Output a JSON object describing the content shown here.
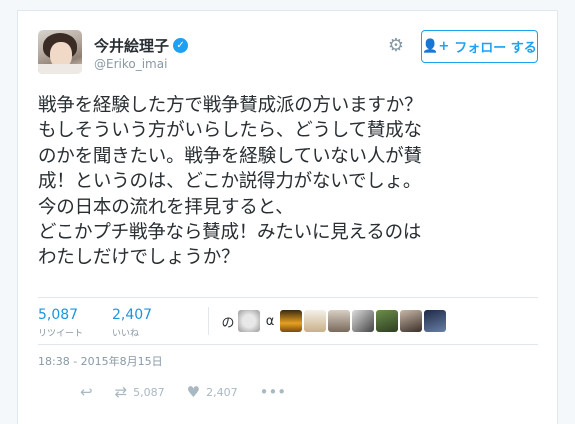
{
  "user": {
    "display_name": "今井絵理子",
    "handle": "@Eriko_imai",
    "verified_icon": "verified-badge-icon"
  },
  "header": {
    "follow_label": "フォロー する"
  },
  "tweet": {
    "lines": [
      "戦争を経験した方で戦争賛成派の方いますか？",
      "もしそういう方がいらしたら、どうして賛成な",
      "のかを聞きたい。戦争を経験していない人が賛",
      "成！というのは、どこか説得力がないでしょ。",
      "今の日本の流れを拝見すると、",
      "どこかプチ戦争なら賛成！みたいに見えるのは",
      "わたしだけでしょうか？"
    ]
  },
  "stats": {
    "retweets": "5,087",
    "retweets_label": "リツイート",
    "likes": "2,407",
    "likes_label": "いいね",
    "faces_glyph_1": "の",
    "faces_glyph_2": "α"
  },
  "timestamp": "18:38 - 2015年8月15日",
  "actions": {
    "retweet_count": "5,087",
    "like_count": "2,407"
  },
  "colors": {
    "accent": "#1da1f2",
    "link": "#1b95e0",
    "muted": "#8899a6"
  }
}
